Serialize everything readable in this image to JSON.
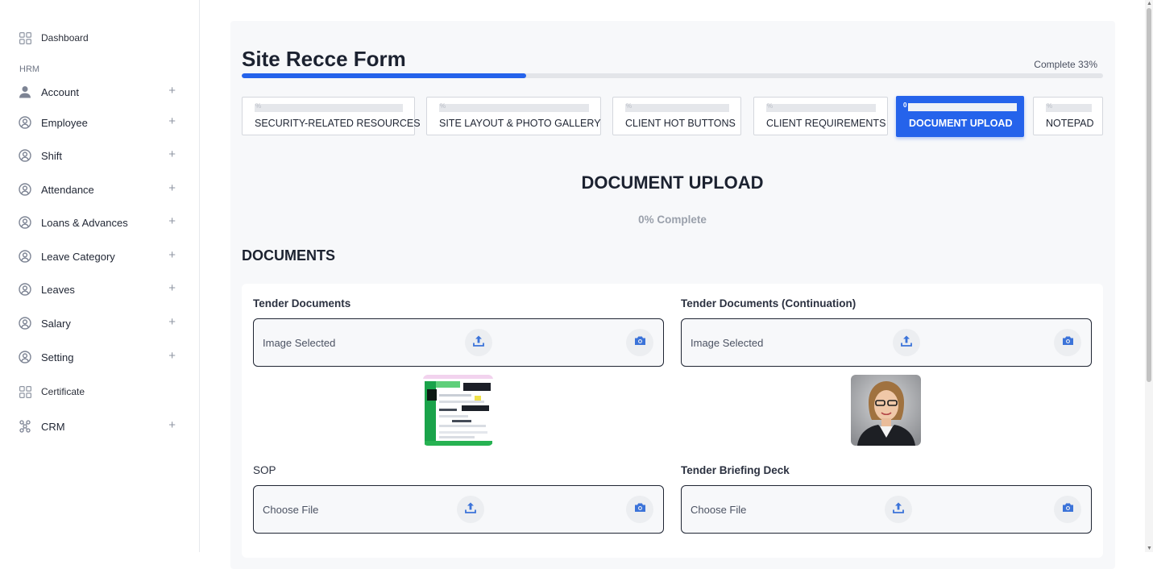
{
  "sidebar": {
    "section_label": "HRM",
    "dashboard": "Dashboard",
    "items": [
      {
        "label": "Account",
        "icon": "user-icon"
      },
      {
        "label": "Employee",
        "icon": "user-circle-icon"
      },
      {
        "label": "Shift",
        "icon": "user-circle-icon"
      },
      {
        "label": "Attendance",
        "icon": "user-circle-icon"
      },
      {
        "label": "Loans & Advances",
        "icon": "user-circle-icon"
      },
      {
        "label": "Leave Category",
        "icon": "user-circle-icon"
      },
      {
        "label": "Leaves",
        "icon": "user-circle-icon"
      },
      {
        "label": "Salary",
        "icon": "user-circle-icon"
      },
      {
        "label": "Setting",
        "icon": "user-circle-icon"
      }
    ],
    "certificate": "Certificate",
    "crm": "CRM",
    "plus": "+"
  },
  "form": {
    "title": "Site Recce Form",
    "complete_label": "Complete 33%",
    "progress_percent": 33
  },
  "tabs": [
    {
      "label": "SECURITY-RELATED RESOURCES"
    },
    {
      "label": "SITE LAYOUT & PHOTO GALLERY"
    },
    {
      "label": "CLIENT HOT BUTTONS"
    },
    {
      "label": "CLIENT REQUIREMENTS"
    },
    {
      "label": "DOCUMENT UPLOAD",
      "active": true
    },
    {
      "label": "NOTEPAD"
    }
  ],
  "section": {
    "title": "DOCUMENT UPLOAD",
    "percent_label": "0% Complete",
    "group_heading": "DOCUMENTS"
  },
  "fields": [
    {
      "label": "Tender Documents",
      "status": "Image Selected"
    },
    {
      "label": "Tender Documents (Continuation)",
      "status": "Image Selected"
    },
    {
      "label": "SOP",
      "status": "Choose File"
    },
    {
      "label": "Tender Briefing Deck",
      "status": "Choose File"
    }
  ],
  "colors": {
    "accent": "#2563eb",
    "icon": "#3b73d9"
  }
}
